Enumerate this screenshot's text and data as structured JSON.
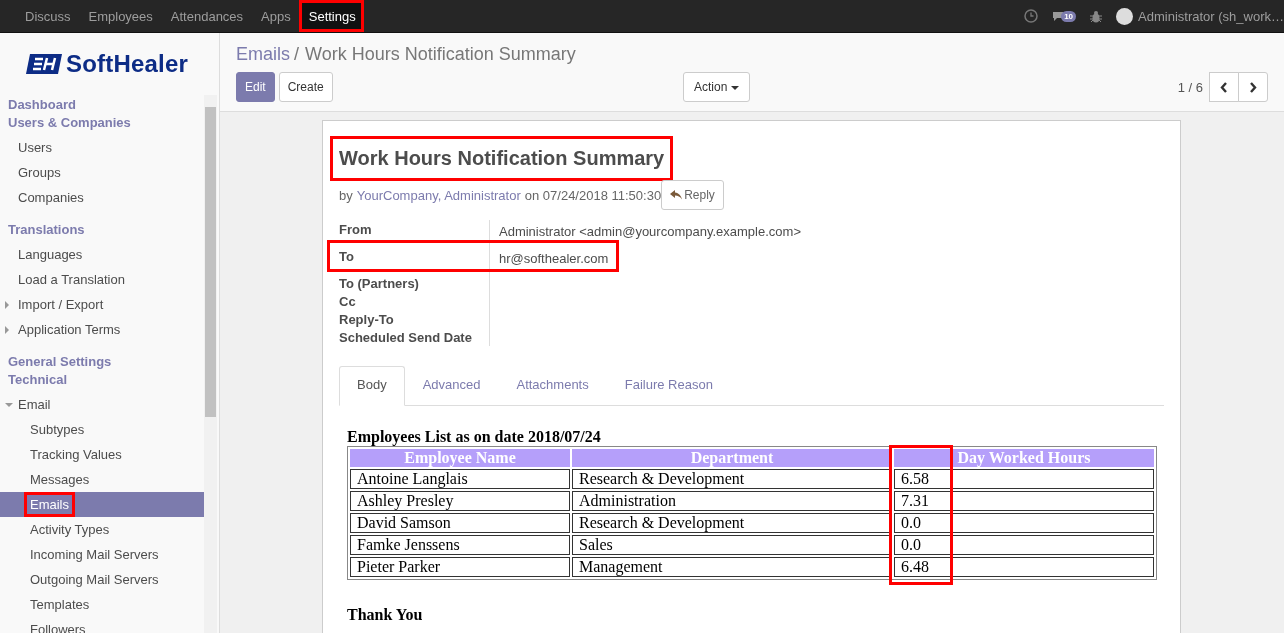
{
  "top_menu": [
    {
      "label": "Discuss",
      "selected": false,
      "highlighted": false
    },
    {
      "label": "Employees",
      "selected": false,
      "highlighted": false
    },
    {
      "label": "Attendances",
      "selected": false,
      "highlighted": false
    },
    {
      "label": "Apps",
      "selected": false,
      "highlighted": false
    },
    {
      "label": "Settings",
      "selected": true,
      "highlighted": true
    }
  ],
  "systray": {
    "message_count": "10",
    "user": "Administrator (sh_work…"
  },
  "logo": {
    "text": "SoftHealer"
  },
  "sidebar": {
    "items": [
      {
        "kind": "section",
        "label": "Dashboard",
        "selected": false,
        "highlighted": false
      },
      {
        "kind": "section",
        "label": "Users & Companies",
        "selected": false,
        "highlighted": false,
        "children": [
          {
            "kind": "item",
            "label": "Users",
            "selected": false,
            "highlighted": false
          },
          {
            "kind": "item",
            "label": "Groups",
            "selected": false,
            "highlighted": false
          },
          {
            "kind": "item",
            "label": "Companies",
            "selected": false,
            "highlighted": false
          }
        ]
      },
      {
        "kind": "section",
        "label": "Translations",
        "selected": false,
        "highlighted": false,
        "children": [
          {
            "kind": "item",
            "label": "Languages",
            "selected": false,
            "highlighted": false
          },
          {
            "kind": "item",
            "label": "Load a Translation",
            "selected": false,
            "highlighted": false
          },
          {
            "kind": "folder",
            "label": "Import / Export",
            "expanded": false,
            "selected": false,
            "highlighted": false
          },
          {
            "kind": "folder",
            "label": "Application Terms",
            "expanded": false,
            "selected": false,
            "highlighted": false
          }
        ]
      },
      {
        "kind": "section",
        "label": "General Settings",
        "selected": false,
        "highlighted": false
      },
      {
        "kind": "section",
        "label": "Technical",
        "selected": false,
        "highlighted": false,
        "children": [
          {
            "kind": "folder",
            "label": "Email",
            "expanded": true,
            "selected": false,
            "highlighted": false,
            "children": [
              {
                "kind": "item",
                "label": "Subtypes",
                "selected": false,
                "highlighted": false
              },
              {
                "kind": "item",
                "label": "Tracking Values",
                "selected": false,
                "highlighted": false
              },
              {
                "kind": "item",
                "label": "Messages",
                "selected": false,
                "highlighted": false
              },
              {
                "kind": "item",
                "label": "Emails",
                "selected": true,
                "highlighted": true
              },
              {
                "kind": "item",
                "label": "Activity Types",
                "selected": false,
                "highlighted": false
              },
              {
                "kind": "item",
                "label": "Incoming Mail Servers",
                "selected": false,
                "highlighted": false
              },
              {
                "kind": "item",
                "label": "Outgoing Mail Servers",
                "selected": false,
                "highlighted": false
              },
              {
                "kind": "item",
                "label": "Templates",
                "selected": false,
                "highlighted": false
              },
              {
                "kind": "item",
                "label": "Followers",
                "selected": false,
                "highlighted": false
              }
            ]
          }
        ]
      }
    ]
  },
  "breadcrumb": {
    "parent": "Emails",
    "separator": "/",
    "current": "Work Hours Notification Summary"
  },
  "buttons": {
    "edit": "Edit",
    "create": "Create",
    "action": "Action"
  },
  "pager": {
    "text": "1 / 6"
  },
  "message": {
    "subject": "Work Hours Notification Summary",
    "subject_highlighted": true,
    "by": "by",
    "author": "YourCompany, Administrator",
    "date": "on 07/24/2018 11:50:30",
    "reply": "Reply",
    "fields": [
      {
        "label": "From",
        "value": "Administrator <admin@yourcompany.example.com>",
        "highlighted": false
      },
      {
        "label": "To",
        "value": "hr@softhealer.com",
        "highlighted": true
      },
      {
        "label": "To (Partners)",
        "highlighted": false
      },
      {
        "label": "Cc",
        "highlighted": false
      },
      {
        "label": "Reply-To",
        "highlighted": false
      },
      {
        "label": "Scheduled Send Date",
        "highlighted": false
      }
    ]
  },
  "tabs": [
    {
      "label": "Body",
      "selected": true
    },
    {
      "label": "Advanced",
      "selected": false
    },
    {
      "label": "Attachments",
      "selected": false
    },
    {
      "label": "Failure Reason",
      "selected": false
    }
  ],
  "body": {
    "heading": "Employees List as on date 2018/07/24",
    "table": {
      "columns": [
        {
          "label": "Employee Name",
          "highlighted": false
        },
        {
          "label": "Department",
          "highlighted": false
        },
        {
          "label": "Day Worked Hours",
          "highlighted": true
        }
      ],
      "rows": [
        [
          "Antoine Langlais",
          "Research & Development",
          "6.58"
        ],
        [
          "Ashley Presley",
          "Administration",
          "7.31"
        ],
        [
          "David Samson",
          "Research & Development",
          "0.0"
        ],
        [
          "Famke Jenssens",
          "Sales",
          "0.0"
        ],
        [
          "Pieter Parker",
          "Management",
          "6.48"
        ]
      ]
    },
    "closing": "Thank You"
  }
}
